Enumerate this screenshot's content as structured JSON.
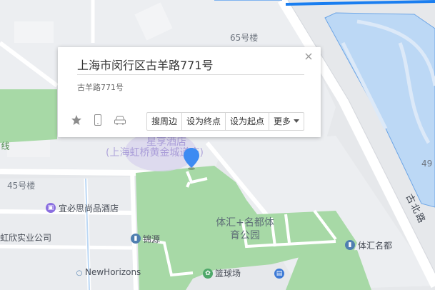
{
  "popup": {
    "title": "上海市闵行区古羊路771号",
    "subtitle": "古羊路771号",
    "actions": [
      "搜周边",
      "设为终点",
      "设为起点"
    ],
    "more_label": "更多",
    "icons": [
      "star-icon",
      "phone-icon",
      "car-icon",
      "close-icon",
      "caret-down-icon"
    ]
  },
  "map_labels": {
    "building_65": "65号楼",
    "building_45": "45号楼",
    "building_49": "49",
    "hotel_partial_1": "星享酒店",
    "hotel_partial_2": "(上海虹桥黄金城道店)",
    "hotel_yibisi": "宜必思尚品酒店",
    "company": "虹欣实业公司",
    "jinyuan": "锦源",
    "newhorizons": "NewHorizons",
    "park_name": "体汇+名都体育公园",
    "basketball": "篮球场",
    "tihui": "体汇名都",
    "road_gubei": "古北路",
    "left_edge": "线"
  },
  "colors": {
    "map_bg": "#e6e8eb",
    "green_area": "#a7d9a6",
    "water_blue": "#bcd8f5",
    "route_blue": "#1a7ef0",
    "pin_blue": "#3d8bf2",
    "poi_purple": "#8b6fe0",
    "poi_blue": "#4f7fb0"
  }
}
